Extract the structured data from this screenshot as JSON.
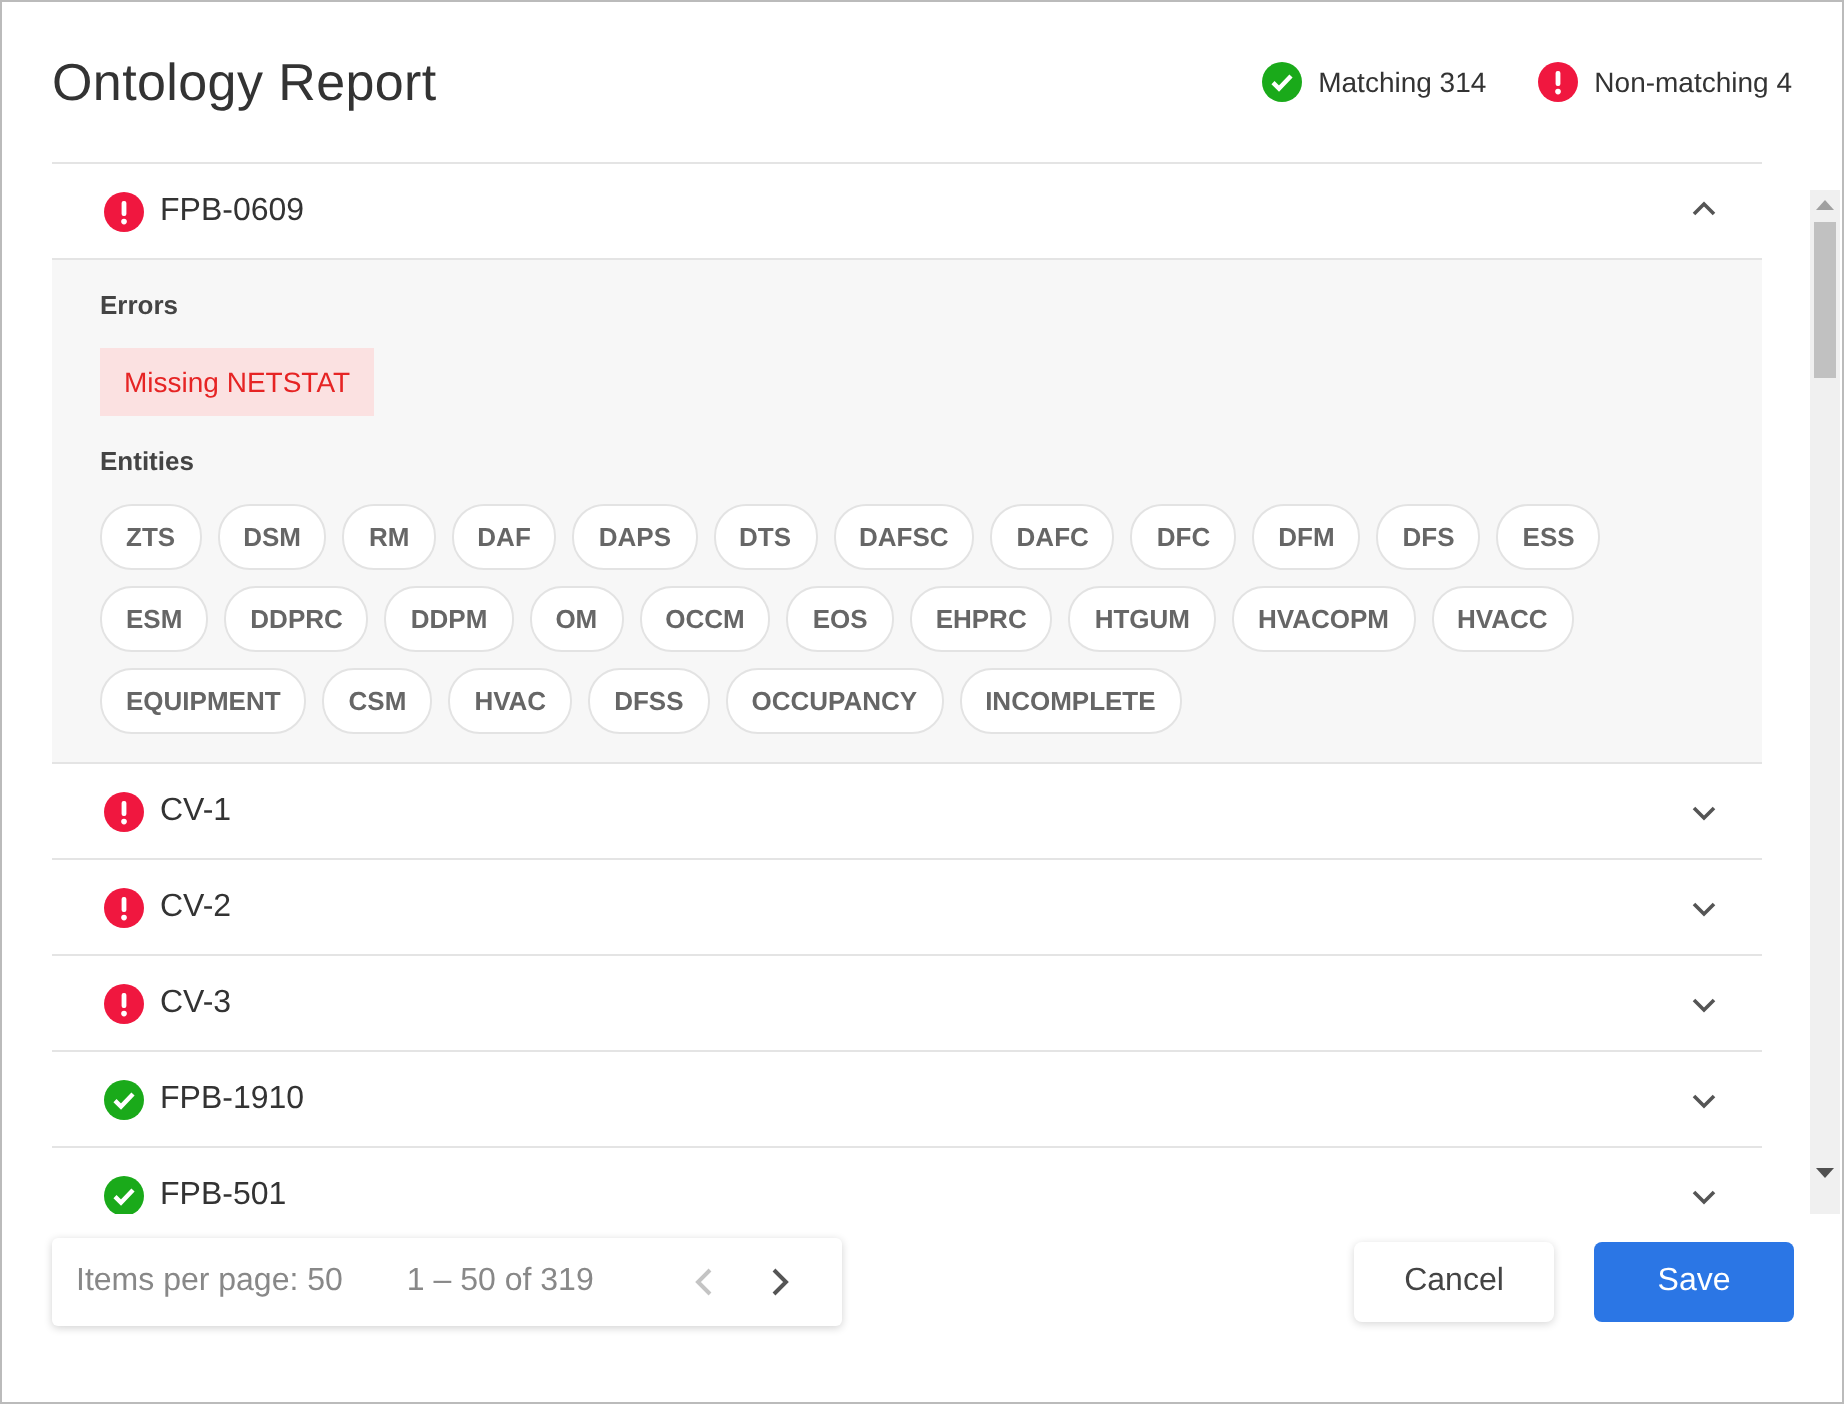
{
  "dialog": {
    "title": "Ontology Report"
  },
  "summary": [
    {
      "kind": "ok",
      "label": "Matching 314"
    },
    {
      "kind": "error",
      "label": "Non-matching 4"
    }
  ],
  "items": [
    {
      "kind": "error",
      "name": "FPB-0609",
      "expanded": true,
      "errors_label": "Errors",
      "errors": [
        "Missing NETSTAT"
      ],
      "entities_label": "Entities",
      "entities": [
        "ZTS",
        "DSM",
        "RM",
        "DAF",
        "DAPS",
        "DTS",
        "DAFSC",
        "DAFC",
        "DFC",
        "DFM",
        "DFS",
        "ESS",
        "ESM",
        "DDPRC",
        "DDPM",
        "OM",
        "OCCM",
        "EOS",
        "EHPRC",
        "HTGUM",
        "HVACOPM",
        "HVACC",
        "EQUIPMENT",
        "CSM",
        "HVAC",
        "DFSS",
        "OCCUPANCY",
        "INCOMPLETE"
      ]
    },
    {
      "kind": "error",
      "name": "CV-1",
      "expanded": false
    },
    {
      "kind": "error",
      "name": "CV-2",
      "expanded": false
    },
    {
      "kind": "error",
      "name": "CV-3",
      "expanded": false
    },
    {
      "kind": "ok",
      "name": "FPB-1910",
      "expanded": false
    },
    {
      "kind": "ok",
      "name": "FPB-501",
      "expanded": false
    }
  ],
  "paginator": {
    "items_per_page": "Items per page: 50",
    "range": "1 – 50 of 319",
    "previous_disabled": true,
    "next_disabled": false
  },
  "buttons": [
    {
      "kind": "secondary",
      "label": "Cancel"
    },
    {
      "kind": "primary",
      "label": "Save"
    }
  ]
}
